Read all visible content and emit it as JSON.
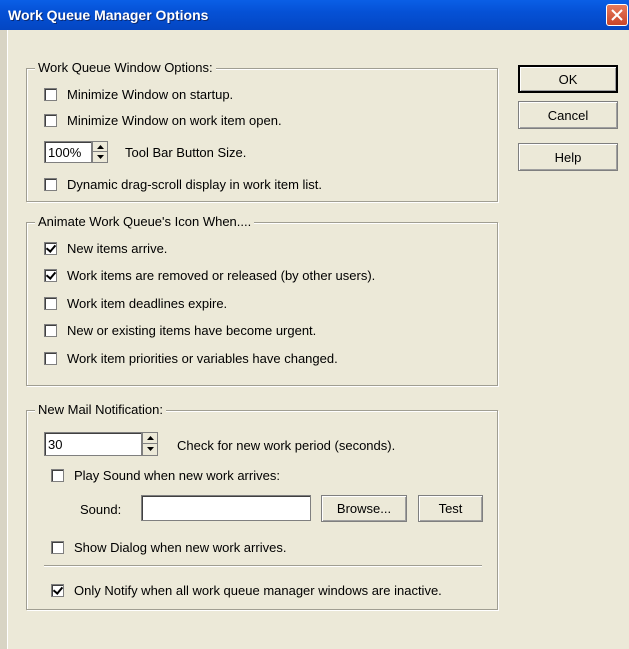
{
  "window": {
    "title": "Work Queue Manager Options"
  },
  "buttons": {
    "ok": "OK",
    "cancel": "Cancel",
    "help": "Help",
    "browse": "Browse...",
    "test": "Test"
  },
  "window_options": {
    "legend": "Work Queue Window Options:",
    "minimize_startup": {
      "label": "Minimize Window on startup.",
      "checked": false
    },
    "minimize_open": {
      "label": "Minimize Window on work item open.",
      "checked": false
    },
    "toolbar_size": {
      "value": "100%",
      "label": "Tool Bar Button Size."
    },
    "dynamic_scroll": {
      "label": "Dynamic drag-scroll display in work item list.",
      "checked": false
    }
  },
  "animate": {
    "legend": "Animate Work Queue's Icon When....",
    "items": [
      {
        "label": "New items arrive.",
        "checked": true
      },
      {
        "label": "Work items are removed or released (by other users).",
        "checked": true
      },
      {
        "label": "Work item deadlines expire.",
        "checked": false
      },
      {
        "label": "New or existing items have become urgent.",
        "checked": false
      },
      {
        "label": "Work item priorities or variables have changed.",
        "checked": false
      }
    ]
  },
  "mail": {
    "legend": "New Mail Notification:",
    "period": {
      "value": "30",
      "label": "Check for new work period (seconds)."
    },
    "play_sound": {
      "label": "Play Sound when new work arrives:",
      "checked": false
    },
    "sound": {
      "label": "Sound:",
      "value": ""
    },
    "show_dialog": {
      "label": "Show Dialog when new work arrives.",
      "checked": false
    },
    "only_notify": {
      "label": "Only Notify when all work queue manager windows are inactive.",
      "checked": true
    }
  }
}
